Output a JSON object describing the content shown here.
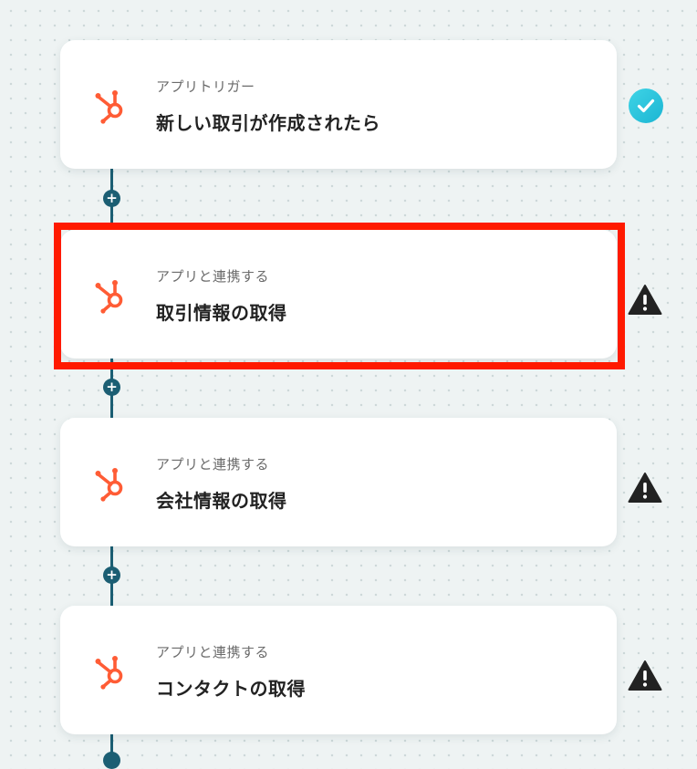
{
  "steps": [
    {
      "subtitle": "アプリトリガー",
      "title": "新しい取引が作成されたら",
      "status": "complete",
      "status_icon": "check-circle-icon",
      "app_icon": "hubspot-icon"
    },
    {
      "subtitle": "アプリと連携する",
      "title": "取引情報の取得",
      "status": "warning",
      "status_icon": "warning-icon",
      "app_icon": "hubspot-icon",
      "highlighted": true
    },
    {
      "subtitle": "アプリと連携する",
      "title": "会社情報の取得",
      "status": "warning",
      "status_icon": "warning-icon",
      "app_icon": "hubspot-icon"
    },
    {
      "subtitle": "アプリと連携する",
      "title": "コンタクトの取得",
      "status": "warning",
      "status_icon": "warning-icon",
      "app_icon": "hubspot-icon"
    }
  ],
  "add_step_symbol": "+",
  "colors": {
    "brand_icon": "#ff5c35",
    "connector": "#1b5e73",
    "highlight": "#ff1a00",
    "check": "#1bb5d3",
    "warning": "#222222"
  }
}
